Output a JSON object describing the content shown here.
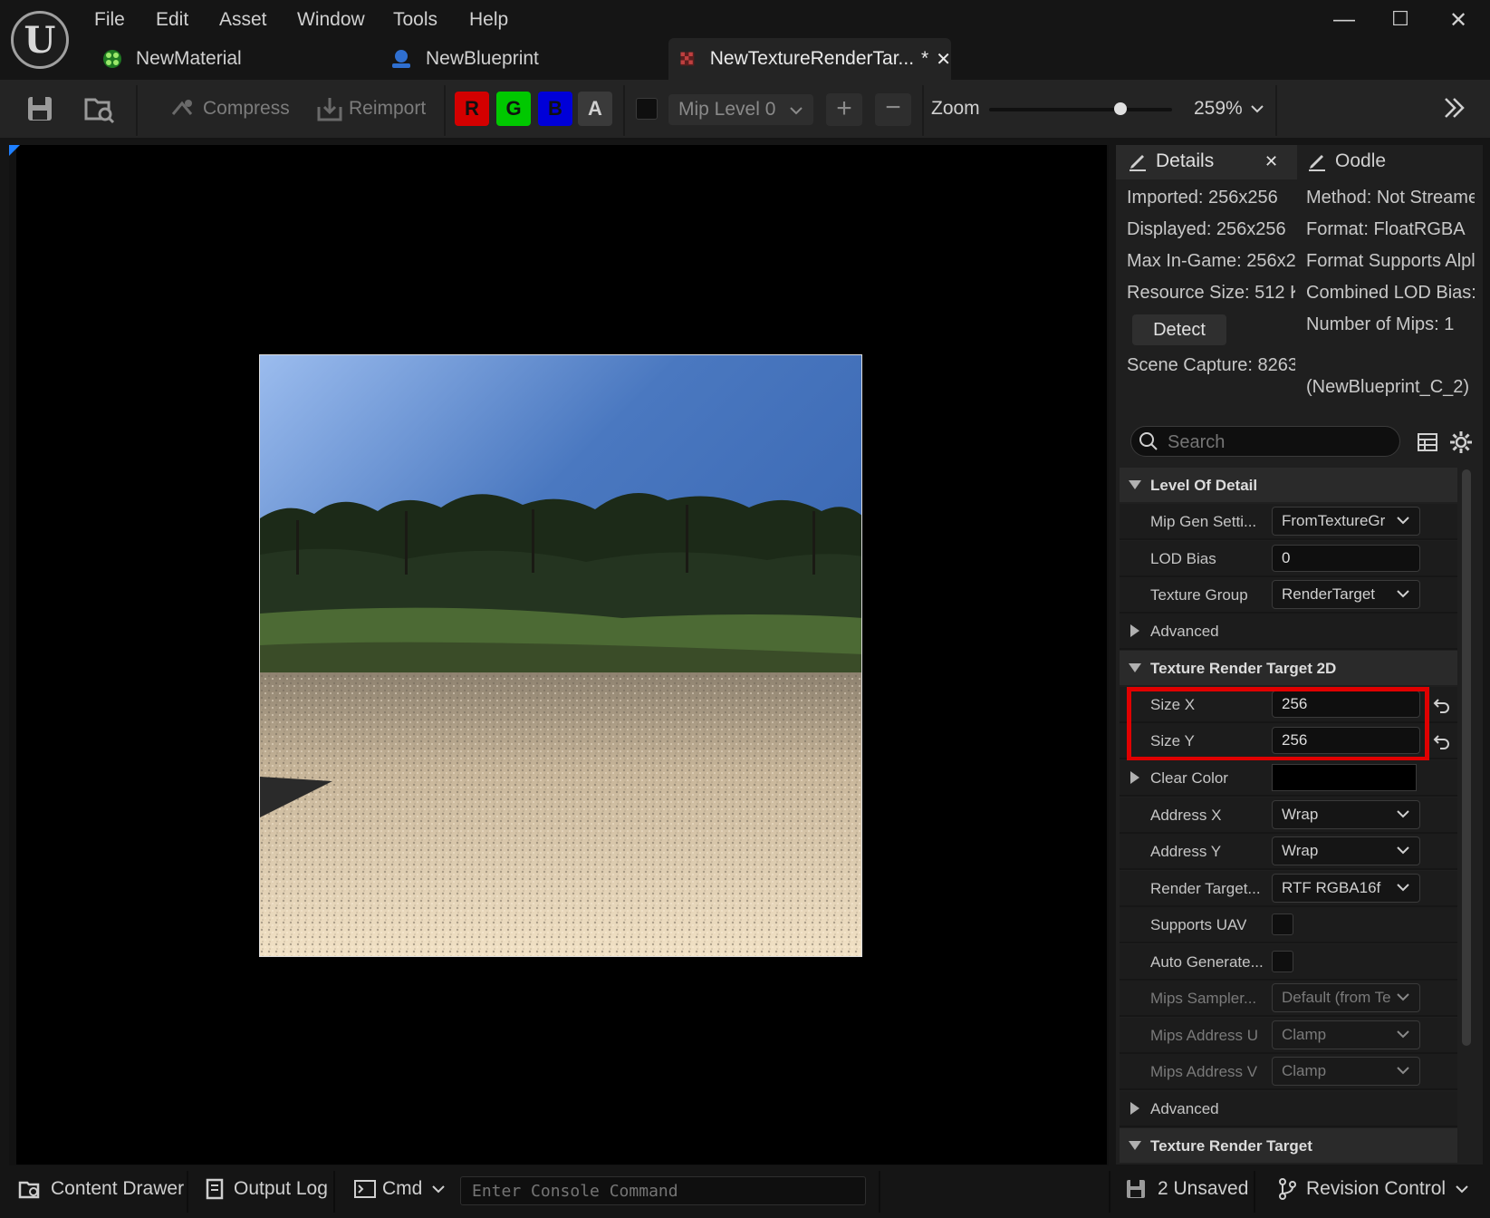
{
  "menu": [
    "File",
    "Edit",
    "Asset",
    "Window",
    "Tools",
    "Help"
  ],
  "tabs": [
    {
      "label": "NewMaterial"
    },
    {
      "label": "NewBlueprint"
    },
    {
      "label": "NewTextureRenderTar...",
      "dirty": "*"
    }
  ],
  "toolbar": {
    "compress": "Compress",
    "reimport": "Reimport",
    "channels": [
      "R",
      "G",
      "B",
      "A"
    ],
    "channel_colors": [
      "#d40000",
      "#00c800",
      "#0000d8",
      "#3a3a3a"
    ],
    "mip_level": "Mip Level 0",
    "zoom_label": "Zoom",
    "zoom_value": "259%",
    "zoom_slider_fraction": 0.72
  },
  "details": {
    "tab_details": "Details",
    "tab_oodle": "Oodle",
    "info_left": [
      "Imported: 256x256",
      "Displayed: 256x256",
      "Max In-Game: 256x2",
      "Resource Size: 512 K"
    ],
    "detect": "Detect",
    "scene_capture": "Scene Capture: 8263",
    "info_right": [
      "Method: Not Streame",
      "Format: FloatRGBA",
      "Format Supports Alpl",
      "Combined LOD Bias:",
      "Number of Mips: 1"
    ],
    "blueprint_ref": "(NewBlueprint_C_2)",
    "search_placeholder": "Search",
    "cat_lod": "Level Of Detail",
    "mip_gen_label": "Mip Gen Setti...",
    "mip_gen_value": "FromTextureGr",
    "lod_bias_label": "LOD Bias",
    "lod_bias_value": "0",
    "texture_group_label": "Texture Group",
    "texture_group_value": "RenderTarget",
    "advanced": "Advanced",
    "cat_trt2d": "Texture Render Target 2D",
    "size_x_label": "Size X",
    "size_x_value": "256",
    "size_y_label": "Size Y",
    "size_y_value": "256",
    "clear_color_label": "Clear Color",
    "address_x_label": "Address X",
    "address_x_value": "Wrap",
    "address_y_label": "Address Y",
    "address_y_value": "Wrap",
    "render_target_label": "Render Target...",
    "render_target_value": "RTF RGBA16f",
    "supports_uav_label": "Supports UAV",
    "auto_generate_label": "Auto Generate...",
    "mips_sampler_label": "Mips Sampler...",
    "mips_sampler_value": "Default (from Te",
    "mips_address_u_label": "Mips Address U",
    "mips_address_u_value": "Clamp",
    "mips_address_v_label": "Mips Address V",
    "mips_address_v_value": "Clamp",
    "advanced2": "Advanced",
    "cat_trt": "Texture Render Target"
  },
  "highlight_color": "#e00000",
  "statusbar": {
    "content_drawer": "Content Drawer",
    "output_log": "Output Log",
    "cmd": "Cmd",
    "console_placeholder": "Enter Console Command",
    "unsaved": "2 Unsaved",
    "revision_control": "Revision Control"
  }
}
